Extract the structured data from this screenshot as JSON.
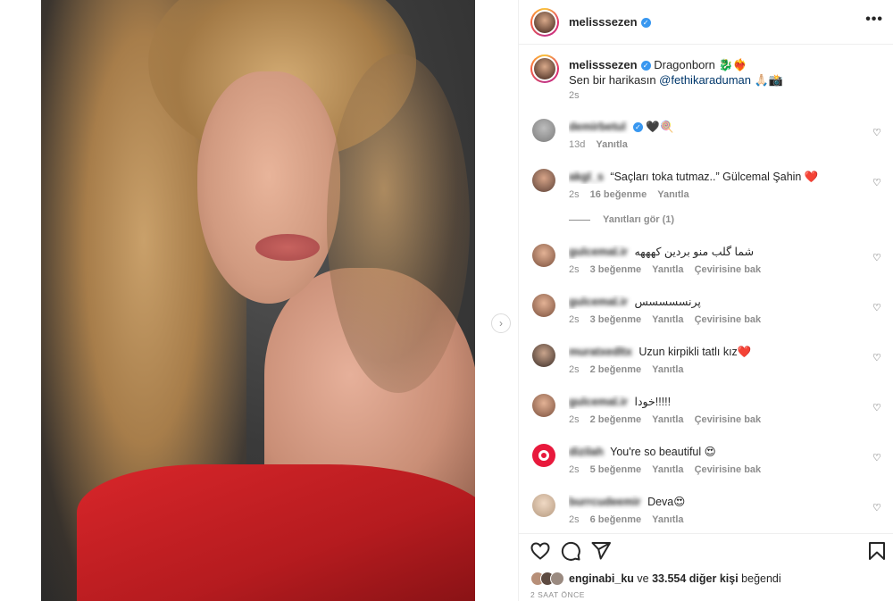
{
  "post": {
    "username": "melisssezen",
    "caption_line1": "Dragonborn 🐉❤️‍🔥",
    "caption_line2_prefix": "Sen bir harikasın ",
    "caption_mention": "@fethikaraduman",
    "caption_line2_suffix": " 🙏🏻📸",
    "time": "2s"
  },
  "comments": [
    {
      "user": "demirbetul",
      "verified": true,
      "text": "🖤🍭",
      "time": "13d",
      "likes": "",
      "reply": "Yanıtla",
      "translate": ""
    },
    {
      "user": "akgl_s",
      "verified": false,
      "text": "“Saçları toka tutmaz..” Gülcemal Şahin ❤️",
      "time": "2s",
      "likes": "16 beğenme",
      "reply": "Yanıtla",
      "translate": ""
    },
    {
      "user": "gulcemal.ir",
      "verified": false,
      "text": "شما گلب منو بردین کهههه",
      "time": "2s",
      "likes": "3 beğenme",
      "reply": "Yanıtla",
      "translate": "Çevirisine bak"
    },
    {
      "user": "gulcemal.ir",
      "verified": false,
      "text": "پرنسسسسس",
      "time": "2s",
      "likes": "3 beğenme",
      "reply": "Yanıtla",
      "translate": "Çevirisine bak"
    },
    {
      "user": "muratxedltx",
      "verified": false,
      "text": "Uzun kirpikli tatlı kız❤️",
      "time": "2s",
      "likes": "2 beğenme",
      "reply": "Yanıtla",
      "translate": ""
    },
    {
      "user": "gulcemal.ir",
      "verified": false,
      "text": "خودا!!!!!",
      "time": "2s",
      "likes": "2 beğenme",
      "reply": "Yanıtla",
      "translate": "Çevirisine bak"
    },
    {
      "user": "dizilah",
      "verified": false,
      "text": "You're so beautiful 😍",
      "time": "2s",
      "likes": "5 beğenme",
      "reply": "Yanıtla",
      "translate": "Çevirisine bak"
    },
    {
      "user": "burrcudeemir",
      "verified": false,
      "text": "Deva😍",
      "time": "2s",
      "likes": "6 beğenme",
      "reply": "Yanıtla",
      "translate": ""
    }
  ],
  "view_replies": "Yanıtları gör (1)",
  "likes": {
    "user": "enginabi_ku",
    "mid": " ve ",
    "count": "33.554 diğer kişi",
    "suffix": " beğendi"
  },
  "ago": "2 SAAT ÖNCE",
  "icons": {
    "like": "heart-icon",
    "comment": "comment-icon",
    "share": "send-icon",
    "save": "bookmark-icon",
    "more": "more-options-icon",
    "next": "chevron-right-icon",
    "verified": "verified-badge-icon"
  },
  "colors": {
    "verified": "#3897f0",
    "link": "#00376b",
    "muted": "#8e8e8e",
    "text": "#262626"
  }
}
